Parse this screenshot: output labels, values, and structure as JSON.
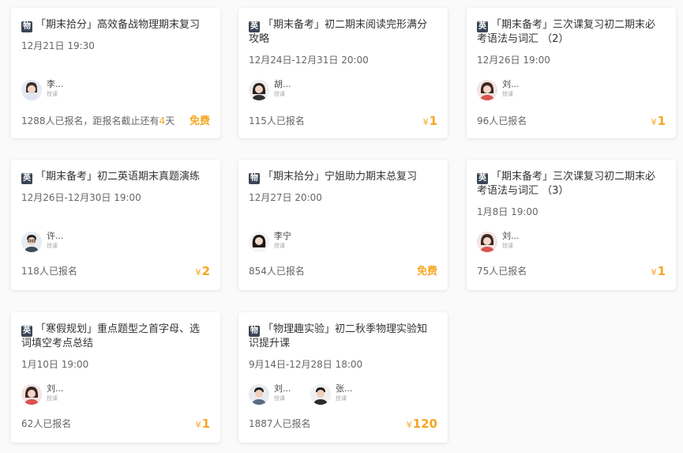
{
  "cards": [
    {
      "subject": "物",
      "title": "「期末拾分」高效备战物理期末复习",
      "time": "12月21日 19:30",
      "teachers": [
        {
          "name": "李...",
          "role": "授课"
        }
      ],
      "enroll_pre": "1288人已报名，距报名截止还有",
      "enroll_num": "4",
      "enroll_post": "天",
      "price_symbol": "",
      "price": "免费"
    },
    {
      "subject": "英",
      "title": "「期末备考」初二期末阅读完形满分攻略",
      "time": "12月24日-12月31日 20:00",
      "teachers": [
        {
          "name": "胡...",
          "role": "授课"
        }
      ],
      "enroll_pre": "115人已报名",
      "price_symbol": "¥",
      "price": "1"
    },
    {
      "subject": "英",
      "title": "「期末备考」三次课复习初二期末必考语法与词汇 （2）",
      "time": "12月26日 19:00",
      "teachers": [
        {
          "name": "刘...",
          "role": "授课"
        }
      ],
      "enroll_pre": "96人已报名",
      "price_symbol": "¥",
      "price": "1"
    },
    {
      "subject": "英",
      "title": "「期末备考」初二英语期末真题演练",
      "time": "12月26日-12月30日 19:00",
      "teachers": [
        {
          "name": "许...",
          "role": "授课"
        }
      ],
      "enroll_pre": "118人已报名",
      "price_symbol": "¥",
      "price": "2"
    },
    {
      "subject": "物",
      "title": "「期末拾分」宁姐助力期末总复习",
      "time": "12月27日 20:00",
      "teachers": [
        {
          "name": "李宁",
          "role": "授课"
        }
      ],
      "enroll_pre": "854人已报名",
      "price_symbol": "",
      "price": "免费"
    },
    {
      "subject": "英",
      "title": "「期末备考」三次课复习初二期末必考语法与词汇 （3）",
      "time": "1月8日 19:00",
      "teachers": [
        {
          "name": "刘...",
          "role": "授课"
        }
      ],
      "enroll_pre": "75人已报名",
      "price_symbol": "¥",
      "price": "1"
    },
    {
      "subject": "英",
      "title": "「寒假规划」重点题型之首字母、选词填空考点总结",
      "time": "1月10日 19:00",
      "teachers": [
        {
          "name": "刘...",
          "role": "授课"
        }
      ],
      "enroll_pre": "62人已报名",
      "price_symbol": "¥",
      "price": "1"
    },
    {
      "subject": "物",
      "title": "「物理趣实验」初二秋季物理实验知识提升课",
      "time": "9月14日-12月28日 18:00",
      "teachers": [
        {
          "name": "刘...",
          "role": "授课"
        },
        {
          "name": "张...",
          "role": "授课"
        }
      ],
      "enroll_pre": "1887人已报名",
      "price_symbol": "¥",
      "price": "120"
    }
  ],
  "colors": {
    "accent": "#f5a623",
    "subject_badge": "#3a4656",
    "card_bg": "#ffffff",
    "page_bg": "#fafafa"
  }
}
